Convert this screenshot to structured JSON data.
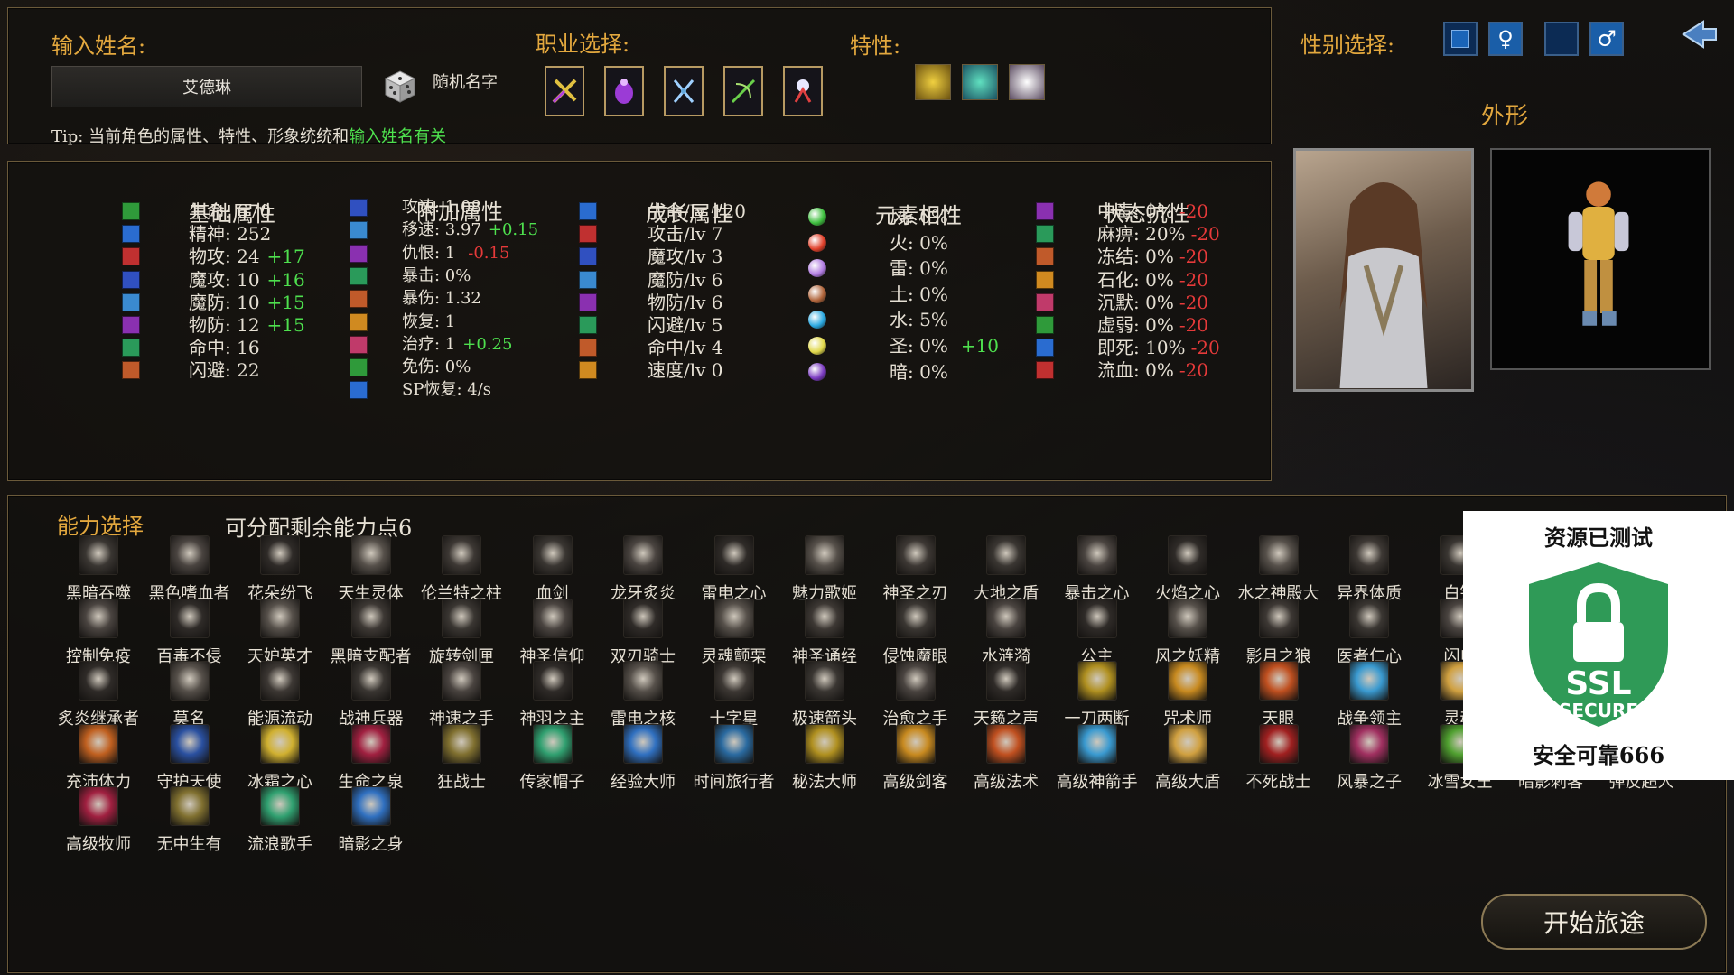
{
  "header": {
    "name_label": "输入姓名:",
    "name_value": "艾德琳",
    "random_name": "随机名字",
    "class_label": "职业选择:",
    "trait_label": "特性:",
    "gender_label": "性别选择:",
    "tip_prefix": "Tip: 当前角色的属性、特性、形象统统和",
    "tip_highlight": "输入姓名有关",
    "appearance": "外形",
    "female_icon": "♀",
    "male_icon": "♂"
  },
  "stats": {
    "headers": [
      "基础属性",
      "附加属性",
      "成长属性",
      "元素相性",
      "状态抗性"
    ],
    "basic": [
      {
        "text": "生命: 670",
        "bonus": ""
      },
      {
        "text": "精神: 252",
        "bonus": ""
      },
      {
        "text": "物攻: 24",
        "bonus": "+17"
      },
      {
        "text": "魔攻: 10",
        "bonus": "+16"
      },
      {
        "text": "魔防: 10",
        "bonus": "+15"
      },
      {
        "text": "物防: 12",
        "bonus": "+15"
      },
      {
        "text": "命中: 16",
        "bonus": ""
      },
      {
        "text": "闪避: 22",
        "bonus": ""
      }
    ],
    "extra": [
      {
        "text": "攻速: 1.08",
        "bonus": "",
        "neg": ""
      },
      {
        "text": "移速: 3.97",
        "bonus": "+0.15",
        "neg": ""
      },
      {
        "text": "仇恨: 1",
        "bonus": "",
        "neg": "-0.15"
      },
      {
        "text": "暴击: 0%",
        "bonus": "",
        "neg": ""
      },
      {
        "text": "暴伤: 1.32",
        "bonus": "",
        "neg": ""
      },
      {
        "text": "恢复: 1",
        "bonus": "",
        "neg": ""
      },
      {
        "text": "治疗: 1",
        "bonus": "+0.25",
        "neg": ""
      },
      {
        "text": "免伤: 0%",
        "bonus": "",
        "neg": ""
      },
      {
        "text": "SP恢复: 4/s",
        "bonus": "",
        "neg": ""
      }
    ],
    "growth": [
      "生命/lv 120",
      "攻击/lv 7",
      "魔攻/lv 3",
      "魔防/lv 6",
      "物防/lv 6",
      "闪避/lv 5",
      "命中/lv 4",
      "速度/lv 0"
    ],
    "element": [
      {
        "text": "风: 0%",
        "bonus": "",
        "color": "#3fbf3f"
      },
      {
        "text": "火: 0%",
        "bonus": "",
        "color": "#e0402a"
      },
      {
        "text": "雷: 0%",
        "bonus": "",
        "color": "#b07ae0"
      },
      {
        "text": "土: 0%",
        "bonus": "",
        "color": "#b0643a"
      },
      {
        "text": "水: 5%",
        "bonus": "",
        "color": "#2aa8e0"
      },
      {
        "text": "圣: 0%",
        "bonus": "+10",
        "color": "#e0d84a"
      },
      {
        "text": "暗: 0%",
        "bonus": "",
        "color": "#7a3ac0"
      }
    ],
    "status": [
      {
        "text": "中毒: 0%",
        "neg": "-20"
      },
      {
        "text": "麻痹: 20%",
        "neg": "-20"
      },
      {
        "text": "冻结: 0%",
        "neg": "-20"
      },
      {
        "text": "石化: 0%",
        "neg": "-20"
      },
      {
        "text": "沉默: 0%",
        "neg": "-20"
      },
      {
        "text": "虚弱: 0%",
        "neg": "-20"
      },
      {
        "text": "即死: 10%",
        "neg": "-20"
      },
      {
        "text": "流血: 0%",
        "neg": "-20"
      }
    ]
  },
  "ability": {
    "title": "能力选择",
    "points": "可分配剩余能力点6",
    "rows": [
      [
        "黑暗吞噬",
        "黑色嗜血者",
        "花朵纷飞",
        "天生灵体",
        "伦兰特之柱",
        "血剑",
        "龙牙炙炎",
        "雷电之心",
        "魅力歌姬",
        "神圣之刃",
        "大地之盾",
        "暴击之心",
        "火焰之心",
        "水之神殿大",
        "异界体质",
        "白银"
      ],
      [
        "控制免疫",
        "百毒不侵",
        "天妒英才",
        "黑暗支配者",
        "旋转剑匣",
        "神圣信仰",
        "双刃骑士",
        "灵魂颤栗",
        "神圣诵经",
        "侵蚀魔眼",
        "水涟漪",
        "公主",
        "风之妖精",
        "影月之狼",
        "医者仁心",
        "闪电"
      ],
      [
        "炙炎继承者",
        "莫名",
        "能源流动",
        "战神兵器",
        "神速之手",
        "神羽之主",
        "雷电之核",
        "十字星",
        "极速箭头",
        "治愈之手",
        "天籁之声",
        "一刀两断",
        "咒术师",
        "天眼",
        "战争领主",
        "灵魂"
      ],
      [
        "充沛体力",
        "守护天使",
        "冰霜之心",
        "生命之泉",
        "狂战士",
        "传家帽子",
        "经验大师",
        "时间旅行者",
        "秘法大师",
        "高级剑客",
        "高级法术",
        "高级神箭手",
        "高级大盾",
        "不死战士",
        "风暴之子",
        "冰雪女王",
        "暗影刺客",
        "弹反超人"
      ],
      [
        "高级牧师",
        "无中生有",
        "流浪歌手",
        "暗影之身"
      ]
    ]
  },
  "ssl": {
    "title": "资源已测试",
    "ssl": "SSL",
    "secure": "SECURE",
    "footer": "安全可靠666"
  },
  "start_button": "开始旅途",
  "colors": {
    "gold": "#e3a83e",
    "bonus_green": "#4ee04e",
    "malus_red": "#e63a3a",
    "shield_green": "#2f9a57"
  }
}
